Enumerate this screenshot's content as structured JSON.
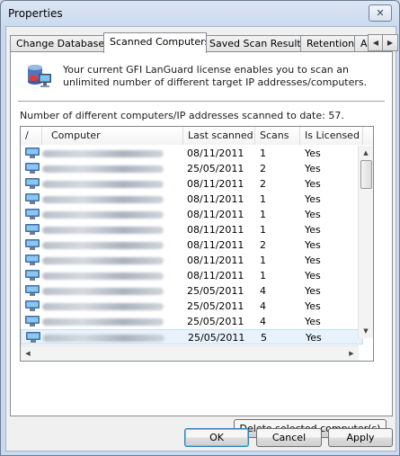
{
  "window": {
    "title": "Properties",
    "close_glyph": "✕"
  },
  "tabs": [
    {
      "label": "Change Database"
    },
    {
      "label": "Scanned Computers",
      "active": true
    },
    {
      "label": "Saved Scan Results"
    },
    {
      "label": "Retention"
    },
    {
      "label": "Ac"
    }
  ],
  "tab_scroll": {
    "left_glyph": "◀",
    "right_glyph": "▶"
  },
  "panel": {
    "info_icon": "database-computer-icon",
    "info_text": "Your current GFI LanGuard license enables you to scan an unlimited number of different target IP addresses/computers.",
    "count_text": "Number of different computers/IP addresses scanned to date: 57."
  },
  "list": {
    "columns": {
      "sort": "/",
      "computer": "Computer",
      "last_scanned": "Last scanned",
      "scans": "Scans",
      "licensed": "Is Licensed"
    },
    "rows": [
      {
        "last_scanned": "08/11/2011",
        "scans": "1",
        "licensed": "Yes"
      },
      {
        "last_scanned": "25/05/2011",
        "scans": "2",
        "licensed": "Yes"
      },
      {
        "last_scanned": "08/11/2011",
        "scans": "2",
        "licensed": "Yes"
      },
      {
        "last_scanned": "08/11/2011",
        "scans": "1",
        "licensed": "Yes"
      },
      {
        "last_scanned": "08/11/2011",
        "scans": "1",
        "licensed": "Yes"
      },
      {
        "last_scanned": "08/11/2011",
        "scans": "1",
        "licensed": "Yes"
      },
      {
        "last_scanned": "08/11/2011",
        "scans": "2",
        "licensed": "Yes"
      },
      {
        "last_scanned": "08/11/2011",
        "scans": "1",
        "licensed": "Yes"
      },
      {
        "last_scanned": "08/11/2011",
        "scans": "1",
        "licensed": "Yes"
      },
      {
        "last_scanned": "25/05/2011",
        "scans": "4",
        "licensed": "Yes"
      },
      {
        "last_scanned": "25/05/2011",
        "scans": "4",
        "licensed": "Yes"
      },
      {
        "last_scanned": "25/05/2011",
        "scans": "4",
        "licensed": "Yes"
      },
      {
        "last_scanned": "25/05/2011",
        "scans": "5",
        "licensed": "Yes",
        "selected": true
      }
    ],
    "scroll_glyphs": {
      "up": "▲",
      "down": "▼",
      "left": "◀",
      "right": "▶"
    }
  },
  "buttons": {
    "delete_selected": "Delete selected computer(s)",
    "ok": "OK",
    "cancel": "Cancel",
    "apply": "Apply"
  },
  "colors": {
    "selection": "#e8f2fc",
    "titlebar": "#c9d9ee",
    "default_button_glow": "#48d4f4"
  }
}
